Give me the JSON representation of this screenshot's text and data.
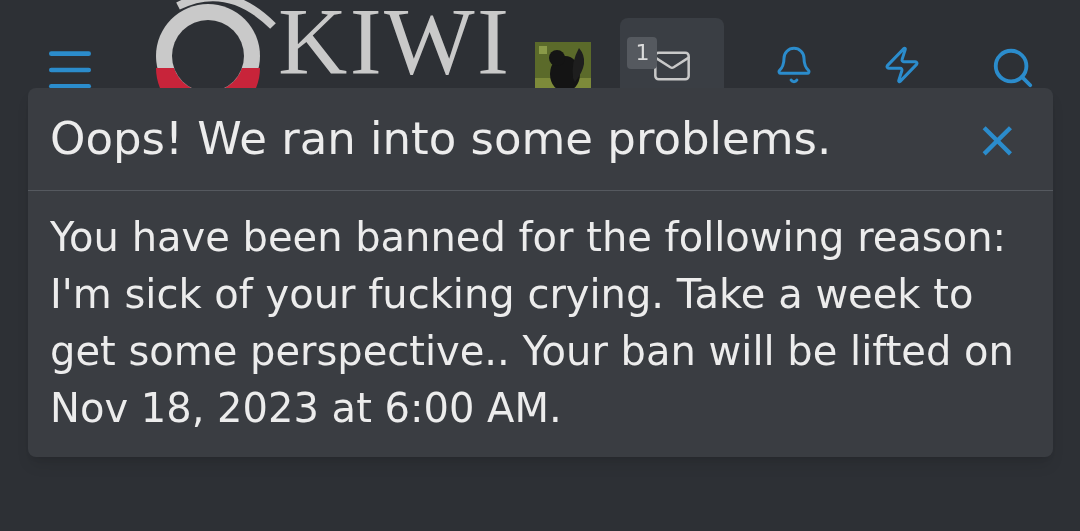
{
  "header": {
    "logo_text": "KIWI",
    "inbox_badge": "1"
  },
  "dialog": {
    "title": "Oops! We ran into some problems.",
    "close": "×",
    "message": "You have been banned for the following reason: I'm sick of your fucking crying. Take a week to get some perspective.. Your ban will be lifted on Nov 18, 2023 at 6:00 AM."
  }
}
